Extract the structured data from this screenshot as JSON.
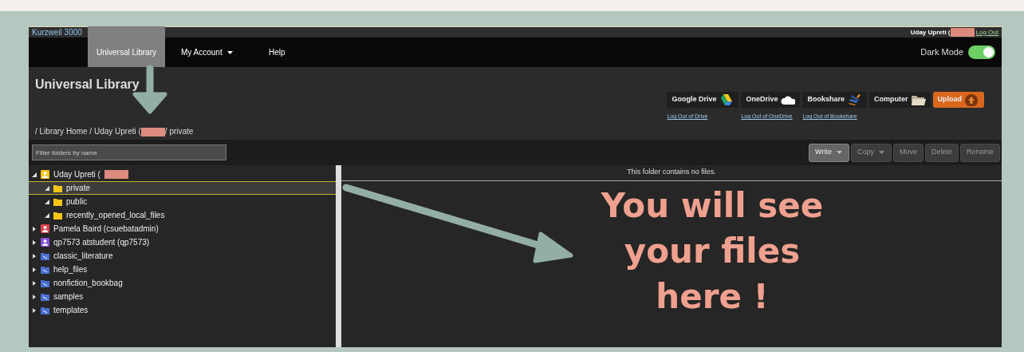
{
  "app": {
    "brand": "Kurzweil 3000",
    "user": "Uday Upreti (",
    "logout": "Log Out"
  },
  "nav": {
    "tabs": [
      {
        "label": "Universal Library",
        "selected": true,
        "dropdown": false
      },
      {
        "label": "My Account",
        "selected": false,
        "dropdown": true
      },
      {
        "label": "Help",
        "selected": false,
        "dropdown": false
      }
    ],
    "dark_mode": {
      "label": "Dark Mode",
      "on": true
    }
  },
  "header": {
    "title": "Universal Library",
    "sources": [
      {
        "label": "Google Drive",
        "kind": "gdrive",
        "logout": "Log Out of Drive"
      },
      {
        "label": "OneDrive",
        "kind": "onedrive",
        "logout": "Log Out of OneDrive"
      },
      {
        "label": "Bookshare",
        "kind": "bookshare",
        "logout": "Log Out of Bookshare"
      },
      {
        "label": "Computer",
        "kind": "computer"
      },
      {
        "label": "Upload",
        "kind": "upload"
      }
    ],
    "breadcrumb": {
      "before": "/ Library Home / Uday Upreti (",
      "after": "/ private"
    }
  },
  "toolbar": {
    "filter": {
      "placeholder": "Filter folders by name"
    },
    "buttons": [
      {
        "label": "Write",
        "disabled": false,
        "dropdown": true
      },
      {
        "label": "Copy",
        "disabled": true,
        "dropdown": true
      },
      {
        "label": "Move",
        "disabled": true,
        "dropdown": false
      },
      {
        "label": "Delete",
        "disabled": true,
        "dropdown": false
      },
      {
        "label": "Rename",
        "disabled": true,
        "dropdown": false
      }
    ]
  },
  "tree": [
    {
      "label": "Uday Upreti (",
      "kind": "user",
      "color": "#f5c518",
      "expanded": true,
      "selected": false,
      "children": [
        {
          "label": "private",
          "kind": "folder",
          "expanded": true,
          "selected": true
        },
        {
          "label": "public",
          "kind": "folder",
          "expanded": true,
          "selected": false
        },
        {
          "label": "recently_opened_local_files",
          "kind": "folder",
          "expanded": true,
          "selected": false
        }
      ]
    },
    {
      "label": "Pamela Baird (csuebatadmin)",
      "kind": "user",
      "color": "#d9434a",
      "expanded": false,
      "selected": false
    },
    {
      "label": "qp7573 atstudent (qp7573)",
      "kind": "user",
      "color": "#8a4fd8",
      "expanded": false,
      "selected": false
    },
    {
      "label": "classic_literature",
      "kind": "shared",
      "expanded": false,
      "selected": false
    },
    {
      "label": "help_files",
      "kind": "shared",
      "expanded": false,
      "selected": false
    },
    {
      "label": "nonfiction_bookbag",
      "kind": "shared",
      "expanded": false,
      "selected": false
    },
    {
      "label": "samples",
      "kind": "shared",
      "expanded": false,
      "selected": false
    },
    {
      "label": "templates",
      "kind": "shared",
      "expanded": false,
      "selected": false
    }
  ],
  "files": {
    "message": "This folder contains no files."
  },
  "annotation": {
    "text": "You will see your files here !"
  }
}
